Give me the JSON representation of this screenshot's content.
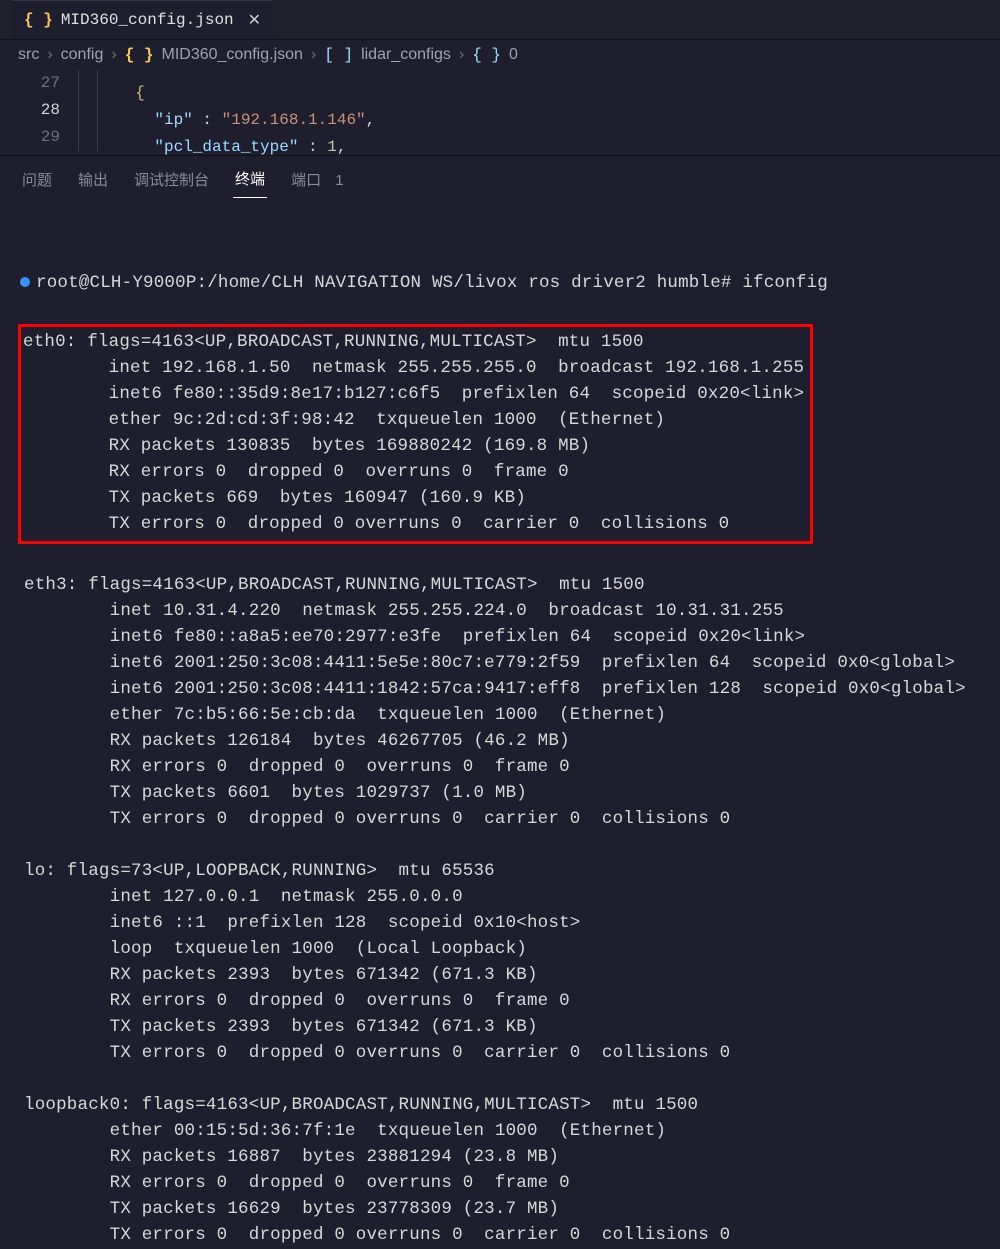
{
  "tab": {
    "filename": "MID360_config.json"
  },
  "breadcrumb": {
    "parts": [
      "src",
      "config",
      "MID360_config.json",
      "lidar_configs",
      "0"
    ]
  },
  "editor": {
    "lines": [
      {
        "num": "27",
        "active": false,
        "indent": 3,
        "tokens": [
          {
            "t": "{",
            "c": "tok-brace"
          }
        ]
      },
      {
        "num": "28",
        "active": true,
        "indent": 4,
        "tokens": [
          {
            "t": "\"ip\"",
            "c": "tok-key"
          },
          {
            "t": " : ",
            "c": "tok-colon"
          },
          {
            "t": "\"192.168.1.146\"",
            "c": "tok-string"
          },
          {
            "t": ",",
            "c": "tok-punc"
          }
        ]
      },
      {
        "num": "29",
        "active": false,
        "indent": 4,
        "tokens": [
          {
            "t": "\"pcl_data_type\"",
            "c": "tok-key"
          },
          {
            "t": " : ",
            "c": "tok-colon"
          },
          {
            "t": "1",
            "c": "tok-num"
          },
          {
            "t": ",",
            "c": "tok-punc"
          }
        ]
      }
    ]
  },
  "panel": {
    "tabs": {
      "problems": "问题",
      "output": "输出",
      "debugConsole": "调试控制台",
      "terminal": "终端",
      "ports": "端口",
      "portsCount": "1"
    }
  },
  "terminal": {
    "prompt": "root@CLH-Y9000P:/home/CLH NAVIGATION WS/livox ros driver2 humble# ifconfig",
    "blocks": [
      {
        "highlight": true,
        "lines": [
          "eth0: flags=4163<UP,BROADCAST,RUNNING,MULTICAST>  mtu 1500",
          "        inet 192.168.1.50  netmask 255.255.255.0  broadcast 192.168.1.255",
          "        inet6 fe80::35d9:8e17:b127:c6f5  prefixlen 64  scopeid 0x20<link>",
          "        ether 9c:2d:cd:3f:98:42  txqueuelen 1000  (Ethernet)",
          "        RX packets 130835  bytes 169880242 (169.8 MB)",
          "        RX errors 0  dropped 0  overruns 0  frame 0",
          "        TX packets 669  bytes 160947 (160.9 KB)",
          "        TX errors 0  dropped 0 overruns 0  carrier 0  collisions 0"
        ]
      },
      {
        "highlight": false,
        "lines": [
          "",
          "eth3: flags=4163<UP,BROADCAST,RUNNING,MULTICAST>  mtu 1500",
          "        inet 10.31.4.220  netmask 255.255.224.0  broadcast 10.31.31.255",
          "        inet6 fe80::a8a5:ee70:2977:e3fe  prefixlen 64  scopeid 0x20<link>",
          "        inet6 2001:250:3c08:4411:5e5e:80c7:e779:2f59  prefixlen 64  scopeid 0x0<global>",
          "        inet6 2001:250:3c08:4411:1842:57ca:9417:eff8  prefixlen 128  scopeid 0x0<global>",
          "        ether 7c:b5:66:5e:cb:da  txqueuelen 1000  (Ethernet)",
          "        RX packets 126184  bytes 46267705 (46.2 MB)",
          "        RX errors 0  dropped 0  overruns 0  frame 0",
          "        TX packets 6601  bytes 1029737 (1.0 MB)",
          "        TX errors 0  dropped 0 overruns 0  carrier 0  collisions 0",
          "",
          "lo: flags=73<UP,LOOPBACK,RUNNING>  mtu 65536",
          "        inet 127.0.0.1  netmask 255.0.0.0",
          "        inet6 ::1  prefixlen 128  scopeid 0x10<host>",
          "        loop  txqueuelen 1000  (Local Loopback)",
          "        RX packets 2393  bytes 671342 (671.3 KB)",
          "        RX errors 0  dropped 0  overruns 0  frame 0",
          "        TX packets 2393  bytes 671342 (671.3 KB)",
          "        TX errors 0  dropped 0 overruns 0  carrier 0  collisions 0",
          "",
          "loopback0: flags=4163<UP,BROADCAST,RUNNING,MULTICAST>  mtu 1500",
          "        ether 00:15:5d:36:7f:1e  txqueuelen 1000  (Ethernet)",
          "        RX packets 16887  bytes 23881294 (23.8 MB)",
          "        RX errors 0  dropped 0  overruns 0  frame 0",
          "        TX packets 16629  bytes 23778309 (23.7 MB)",
          "        TX errors 0  dropped 0 overruns 0  carrier 0  collisions 0"
        ]
      }
    ]
  }
}
